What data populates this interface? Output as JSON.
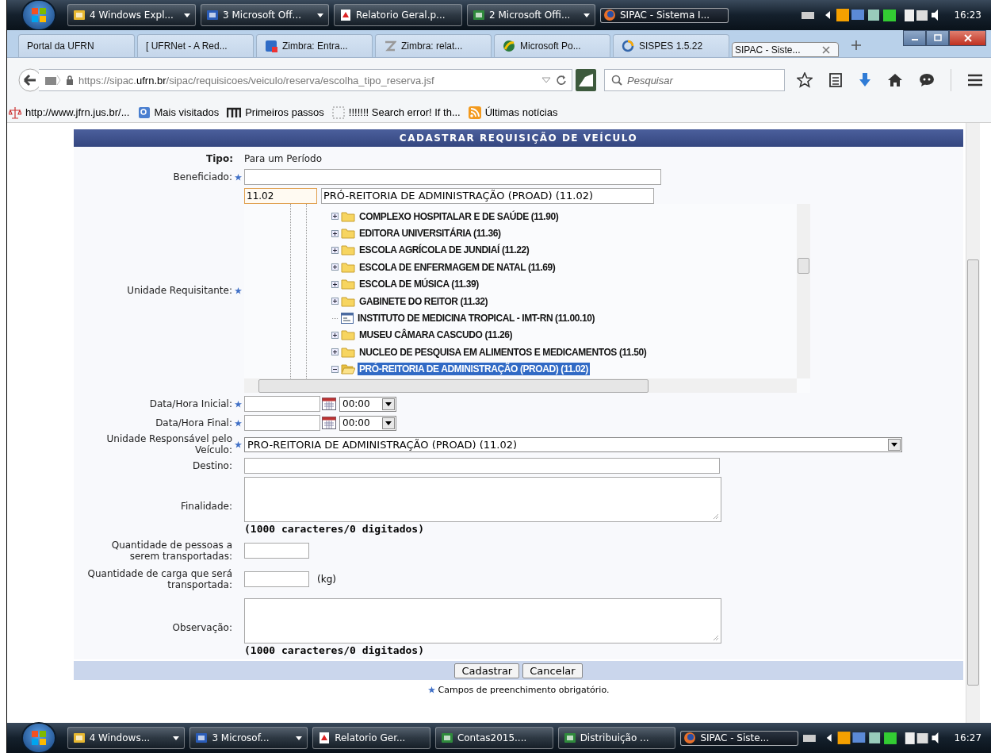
{
  "taskbars": [
    {
      "buttons": [
        {
          "label": "4 Windows Expl...",
          "kind": "folder",
          "grouped": true,
          "selected": false
        },
        {
          "label": "3 Microsoft Off...",
          "kind": "word",
          "grouped": true,
          "selected": false
        },
        {
          "label": "Relatorio Geral.p...",
          "kind": "pdf",
          "grouped": false,
          "selected": false
        },
        {
          "label": "2 Microsoft Offi...",
          "kind": "excel",
          "grouped": true,
          "selected": false
        },
        {
          "label": "SIPAC - Sistema I...",
          "kind": "firefox",
          "grouped": false,
          "selected": true
        }
      ],
      "clock": "16:23"
    },
    {
      "buttons": [
        {
          "label": "4 Windows...",
          "kind": "folder",
          "grouped": true,
          "selected": false
        },
        {
          "label": "3 Microsof...",
          "kind": "word",
          "grouped": true,
          "selected": false
        },
        {
          "label": "Relatorio Ger...",
          "kind": "pdf",
          "grouped": false,
          "selected": false
        },
        {
          "label": "Contas2015....",
          "kind": "excel",
          "grouped": false,
          "selected": false
        },
        {
          "label": "Distribuição ...",
          "kind": "excel",
          "grouped": false,
          "selected": false
        },
        {
          "label": "SIPAC - Siste...",
          "kind": "firefox",
          "grouped": false,
          "selected": true
        }
      ],
      "clock": "16:27"
    }
  ],
  "browser": {
    "tabs": [
      {
        "label": "Portal da UFRN",
        "kind": "none",
        "selected": false
      },
      {
        "label": "[ UFRNet - A Red...",
        "kind": "none",
        "selected": false
      },
      {
        "label": "Zimbra: Entra...",
        "kind": "mail",
        "selected": false
      },
      {
        "label": "Zimbra: relat...",
        "kind": "zimbra",
        "selected": false
      },
      {
        "label": "Microsoft Po...",
        "kind": "globe",
        "selected": false
      },
      {
        "label": "SISPES 1.5.22",
        "kind": "loading",
        "selected": false
      },
      {
        "label": "SIPAC - Siste...",
        "kind": "none",
        "selected": true
      }
    ],
    "url": {
      "prefix": "https://sipac.",
      "domain": "ufrn.br",
      "path": "/sipac/requisicoes/veiculo/reserva/escolha_tipo_reserva.jsf"
    },
    "search_placeholder": "Pesquisar",
    "bookmarks": [
      {
        "label": "http://www.jfrn.jus.br/...",
        "kind": "scale"
      },
      {
        "label": "Mais visitados",
        "kind": "page"
      },
      {
        "label": "Primeiros passos",
        "kind": "m"
      },
      {
        "label": "!!!!!!! Search error! If th...",
        "kind": "blank"
      },
      {
        "label": "Últimas notícias",
        "kind": "rss"
      }
    ]
  },
  "form": {
    "title": "CADASTRAR REQUISIÇÃO DE VEÍCULO",
    "fields": [
      {
        "kind": "static",
        "label": "Tipo:",
        "value": "Para um Período"
      },
      {
        "kind": "text",
        "label": "Beneficiado:",
        "required": true
      },
      {
        "kind": "unit_picker",
        "label": "Unidade Requisitante:",
        "required": true,
        "code": "11.02",
        "name": "PRÓ-REITORIA DE ADMINISTRAÇÃO (PROAD) (11.02)",
        "tree": [
          {
            "label": "COMPLEXO HOSPITALAR E DE SAÚDE (11.90)",
            "kind": "folder",
            "expanded": false,
            "selected": false
          },
          {
            "label": "EDITORA UNIVERSITÁRIA (11.36)",
            "kind": "folder",
            "expanded": false,
            "selected": false
          },
          {
            "label": "ESCOLA AGRÍCOLA DE JUNDIAÍ (11.22)",
            "kind": "folder",
            "expanded": false,
            "selected": false
          },
          {
            "label": "ESCOLA DE ENFERMAGEM DE NATAL (11.69)",
            "kind": "folder",
            "expanded": false,
            "selected": false
          },
          {
            "label": "ESCOLA DE MÚSICA (11.39)",
            "kind": "folder",
            "expanded": false,
            "selected": false
          },
          {
            "label": "GABINETE DO REITOR (11.32)",
            "kind": "folder",
            "expanded": false,
            "selected": false
          },
          {
            "label": "INSTITUTO DE MEDICINA TROPICAL - IMT-RN (11.00.10)",
            "kind": "unit",
            "selected": false
          },
          {
            "label": "MUSEU CÂMARA CASCUDO (11.26)",
            "kind": "folder",
            "expanded": false,
            "selected": false
          },
          {
            "label": "NUCLEO DE PESQUISA EM ALIMENTOS E MEDICAMENTOS (11.50)",
            "kind": "folder",
            "expanded": false,
            "selected": false
          },
          {
            "label": "PRÓ-REITORIA DE ADMINISTRAÇÃO (PROAD) (11.02)",
            "kind": "folder",
            "expanded": true,
            "selected": true
          }
        ]
      },
      {
        "kind": "datetime",
        "label": "Data/Hora Inicial:",
        "required": true,
        "time": "00:00"
      },
      {
        "kind": "datetime",
        "label": "Data/Hora Final:",
        "required": true,
        "time": "00:00"
      },
      {
        "kind": "select",
        "label": "Unidade Responsável pelo Veículo:",
        "required": true,
        "value": "PRO-REITORIA DE ADMINISTRAÇÃO (PROAD) (11.02)"
      },
      {
        "kind": "text",
        "label": "Destino:",
        "required": false
      },
      {
        "kind": "textarea",
        "label": "Finalidade:",
        "required": false,
        "counter": "(1000 caracteres/0 digitados)"
      },
      {
        "kind": "number",
        "label": "Quantidade de pessoas a serem transportadas:",
        "required": false
      },
      {
        "kind": "number",
        "label": "Quantidade de carga que será transportada:",
        "required": false,
        "unit": "(kg)"
      },
      {
        "kind": "textarea",
        "label": "Observação:",
        "required": false,
        "counter": "(1000 caracteres/0 digitados)"
      }
    ],
    "buttons": [
      "Cadastrar",
      "Cancelar"
    ],
    "note": "Campos de preenchimento obrigatório."
  }
}
